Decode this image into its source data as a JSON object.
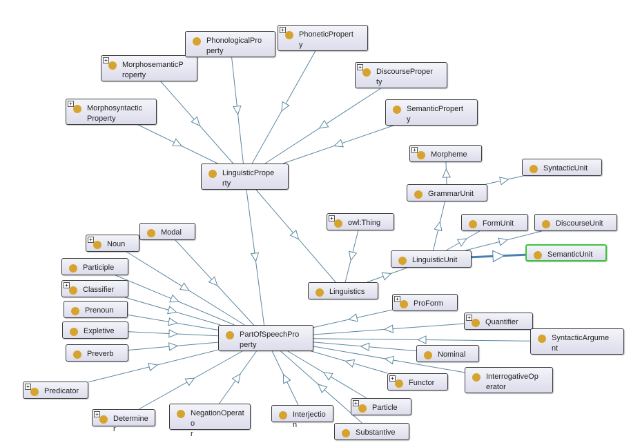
{
  "diagram": {
    "selected_node": "SemanticUnit",
    "colors": {
      "node_dot": "#d6a32e",
      "edge": "#5b86a0",
      "selected_border": "#3cc43c",
      "highlight_edge": "#4a7fb0"
    },
    "nodes": [
      {
        "id": "MorphosyntacticProperty",
        "label": "Morphosyntactic Property",
        "expandable": true
      },
      {
        "id": "MorphosemanticProperty",
        "label": "MorphosemanticP roperty",
        "expandable": true
      },
      {
        "id": "PhonologicalProperty",
        "label": "PhonologicalPro perty",
        "expandable": false
      },
      {
        "id": "PhoneticProperty",
        "label": "PhoneticPropert y",
        "expandable": true
      },
      {
        "id": "DiscourseProperty",
        "label": "DiscourseProper ty",
        "expandable": true
      },
      {
        "id": "SemanticProperty",
        "label": "SemanticPropert y",
        "expandable": false
      },
      {
        "id": "LinguisticProperty",
        "label": "LinguisticPrope rty",
        "expandable": false
      },
      {
        "id": "Morpheme",
        "label": "Morpheme",
        "expandable": true
      },
      {
        "id": "SyntacticUnit",
        "label": "SyntacticUnit",
        "expandable": false
      },
      {
        "id": "GrammarUnit",
        "label": "GrammarUnit",
        "expandable": false
      },
      {
        "id": "owlThing",
        "label": "owl:Thing",
        "expandable": true
      },
      {
        "id": "FormUnit",
        "label": "FormUnit",
        "expandable": false
      },
      {
        "id": "DiscourseUnit",
        "label": "DiscourseUnit",
        "expandable": false
      },
      {
        "id": "LinguisticUnit",
        "label": "LinguisticUnit",
        "expandable": false
      },
      {
        "id": "SemanticUnit",
        "label": "SemanticUnit",
        "expandable": false
      },
      {
        "id": "Linguistics",
        "label": "Linguistics",
        "expandable": false
      },
      {
        "id": "Modal",
        "label": "Modal",
        "expandable": false
      },
      {
        "id": "Noun",
        "label": "Noun",
        "expandable": true
      },
      {
        "id": "Participle",
        "label": "Participle",
        "expandable": false
      },
      {
        "id": "Classifier",
        "label": "Classifier",
        "expandable": true
      },
      {
        "id": "Prenoun",
        "label": "Prenoun",
        "expandable": false
      },
      {
        "id": "Expletive",
        "label": "Expletive",
        "expandable": false
      },
      {
        "id": "Preverb",
        "label": "Preverb",
        "expandable": false
      },
      {
        "id": "PartOfSpeechProperty",
        "label": "PartOfSpeechPro perty",
        "expandable": false
      },
      {
        "id": "ProForm",
        "label": "ProForm",
        "expandable": true
      },
      {
        "id": "Quantifier",
        "label": "Quantifier",
        "expandable": true
      },
      {
        "id": "SyntacticArgument",
        "label": "SyntacticArgume nt",
        "expandable": false
      },
      {
        "id": "Nominal",
        "label": "Nominal",
        "expandable": false
      },
      {
        "id": "InterrogativeOperator",
        "label": "InterrogativeOp erator",
        "expandable": false
      },
      {
        "id": "Functor",
        "label": "Functor",
        "expandable": true
      },
      {
        "id": "Predicator",
        "label": "Predicator",
        "expandable": true
      },
      {
        "id": "Determiner",
        "label": "Determiner",
        "expandable": true
      },
      {
        "id": "NegationOperator",
        "label": "NegationOperato r",
        "expandable": false
      },
      {
        "id": "Interjection",
        "label": "Interjection",
        "expandable": false
      },
      {
        "id": "Particle",
        "label": "Particle",
        "expandable": true
      },
      {
        "id": "Substantive",
        "label": "Substantive",
        "expandable": false
      }
    ],
    "edges": [
      {
        "child": "MorphosyntacticProperty",
        "parent": "LinguisticProperty"
      },
      {
        "child": "MorphosemanticProperty",
        "parent": "LinguisticProperty"
      },
      {
        "child": "PhonologicalProperty",
        "parent": "LinguisticProperty"
      },
      {
        "child": "PhoneticProperty",
        "parent": "LinguisticProperty"
      },
      {
        "child": "DiscourseProperty",
        "parent": "LinguisticProperty"
      },
      {
        "child": "SemanticProperty",
        "parent": "LinguisticProperty"
      },
      {
        "child": "LinguisticProperty",
        "parent": "PartOfSpeechProperty"
      },
      {
        "child": "LinguisticProperty",
        "parent": "Linguistics"
      },
      {
        "child": "owlThing",
        "parent": "Linguistics"
      },
      {
        "child": "Linguistics",
        "parent": "LinguisticUnit"
      },
      {
        "child": "LinguisticUnit",
        "parent": "GrammarUnit"
      },
      {
        "child": "GrammarUnit",
        "parent": "Morpheme"
      },
      {
        "child": "GrammarUnit",
        "parent": "SyntacticUnit"
      },
      {
        "child": "LinguisticUnit",
        "parent": "FormUnit"
      },
      {
        "child": "LinguisticUnit",
        "parent": "DiscourseUnit"
      },
      {
        "child": "LinguisticUnit",
        "parent": "SemanticUnit",
        "highlight": true
      },
      {
        "child": "Modal",
        "parent": "PartOfSpeechProperty"
      },
      {
        "child": "Noun",
        "parent": "PartOfSpeechProperty"
      },
      {
        "child": "Participle",
        "parent": "PartOfSpeechProperty"
      },
      {
        "child": "Classifier",
        "parent": "PartOfSpeechProperty"
      },
      {
        "child": "Prenoun",
        "parent": "PartOfSpeechProperty"
      },
      {
        "child": "Expletive",
        "parent": "PartOfSpeechProperty"
      },
      {
        "child": "Preverb",
        "parent": "PartOfSpeechProperty"
      },
      {
        "child": "Predicator",
        "parent": "PartOfSpeechProperty"
      },
      {
        "child": "Determiner",
        "parent": "PartOfSpeechProperty"
      },
      {
        "child": "NegationOperator",
        "parent": "PartOfSpeechProperty"
      },
      {
        "child": "Interjection",
        "parent": "PartOfSpeechProperty"
      },
      {
        "child": "Substantive",
        "parent": "PartOfSpeechProperty"
      },
      {
        "child": "Particle",
        "parent": "PartOfSpeechProperty"
      },
      {
        "child": "Functor",
        "parent": "PartOfSpeechProperty"
      },
      {
        "child": "InterrogativeOperator",
        "parent": "PartOfSpeechProperty"
      },
      {
        "child": "Nominal",
        "parent": "PartOfSpeechProperty"
      },
      {
        "child": "SyntacticArgument",
        "parent": "PartOfSpeechProperty"
      },
      {
        "child": "Quantifier",
        "parent": "PartOfSpeechProperty"
      },
      {
        "child": "ProForm",
        "parent": "PartOfSpeechProperty"
      }
    ]
  }
}
